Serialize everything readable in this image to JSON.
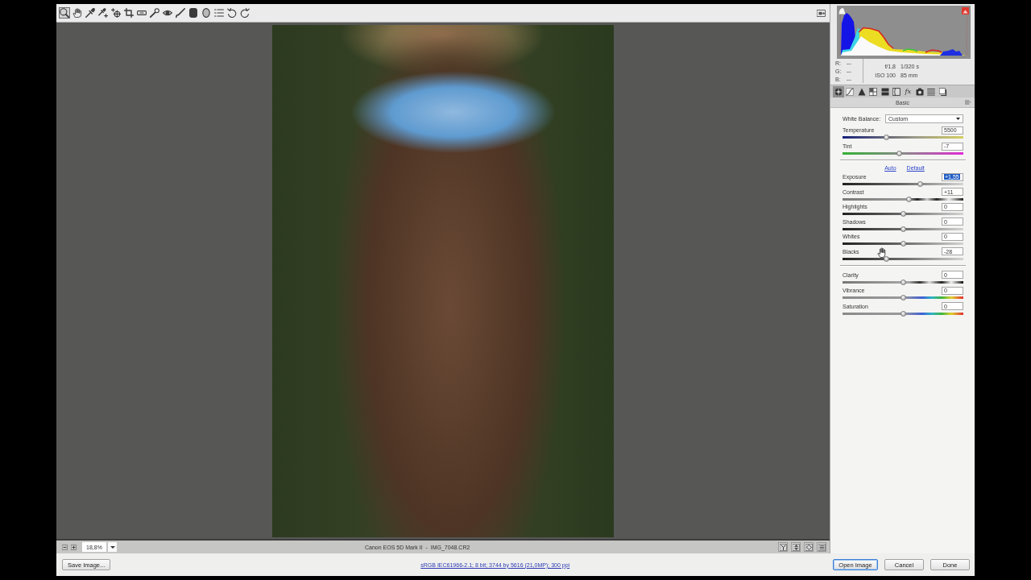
{
  "toolbar": {
    "tools": [
      {
        "selected": true
      },
      {
        "selected": false
      },
      {
        "selected": false
      },
      {
        "selected": false
      },
      {
        "selected": false
      },
      {
        "selected": false
      },
      {
        "selected": false
      },
      {
        "selected": false
      },
      {
        "selected": false
      },
      {
        "selected": false
      },
      {
        "selected": false
      },
      {
        "selected": false
      },
      {
        "selected": false
      },
      {
        "selected": false
      },
      {
        "selected": false
      }
    ]
  },
  "readout": {
    "channels": [
      {
        "label": "R:",
        "value": "---"
      },
      {
        "label": "G:",
        "value": "---"
      },
      {
        "label": "B:",
        "value": "---"
      }
    ],
    "aperture": "f/1,8",
    "shutter": "1/320 s",
    "iso": "ISO 100",
    "focal_length": "85 mm"
  },
  "panel_tabs": [
    {
      "selected": true
    },
    {
      "selected": false
    },
    {
      "selected": false
    },
    {
      "selected": false
    },
    {
      "selected": false
    },
    {
      "selected": false
    },
    {
      "selected": false,
      "glyph": "fx"
    },
    {
      "selected": false
    },
    {
      "selected": false
    },
    {
      "selected": false
    }
  ],
  "panel_title": "Basic",
  "white_balance": {
    "label": "White Balance:",
    "value": "Custom"
  },
  "color_sliders": [
    {
      "kind": "temperature",
      "label": "Temperature",
      "value": "5500",
      "level": 0.36,
      "highlighted": false
    },
    {
      "kind": "tint",
      "label": "Tint",
      "value": "-7",
      "level": 0.47,
      "highlighted": false
    }
  ],
  "links": [
    "Auto",
    "Default"
  ],
  "tone_sliders": [
    {
      "kind": "tone",
      "label": "Exposure",
      "value": "+1,55",
      "level": 0.65,
      "highlighted": true
    },
    {
      "kind": "contrast",
      "label": "Contrast",
      "value": "+11",
      "level": 0.555,
      "highlighted": false
    },
    {
      "kind": "tone",
      "label": "Highlights",
      "value": "0",
      "level": 0.5,
      "highlighted": false
    },
    {
      "kind": "tone",
      "label": "Shadows",
      "value": "0",
      "level": 0.5,
      "highlighted": false
    },
    {
      "kind": "tone",
      "label": "Whites",
      "value": "0",
      "level": 0.5,
      "highlighted": false
    },
    {
      "kind": "tone",
      "label": "Blacks",
      "value": "-28",
      "level": 0.36,
      "highlighted": false
    }
  ],
  "presence_sliders": [
    {
      "kind": "clarity",
      "label": "Clarity",
      "value": "0",
      "level": 0.5,
      "highlighted": false
    },
    {
      "kind": "color",
      "label": "Vibrance",
      "value": "0",
      "level": 0.5,
      "highlighted": false
    },
    {
      "kind": "color",
      "label": "Saturation",
      "value": "0",
      "level": 0.5,
      "highlighted": false
    }
  ],
  "status_bar": {
    "zoom": "18,8%",
    "file": "Canon EOS 5D Mark II  -  IMG_7048.CR2"
  },
  "save_button": "Save Image...",
  "info_link": "sRGB IEC61966-2.1; 8 bit; 3744 by 5616 (21,0MP); 300 ppi",
  "buttons": [
    {
      "label": "Open Image",
      "default": true
    },
    {
      "label": "Cancel",
      "default": false
    },
    {
      "label": "Done",
      "default": false
    }
  ]
}
